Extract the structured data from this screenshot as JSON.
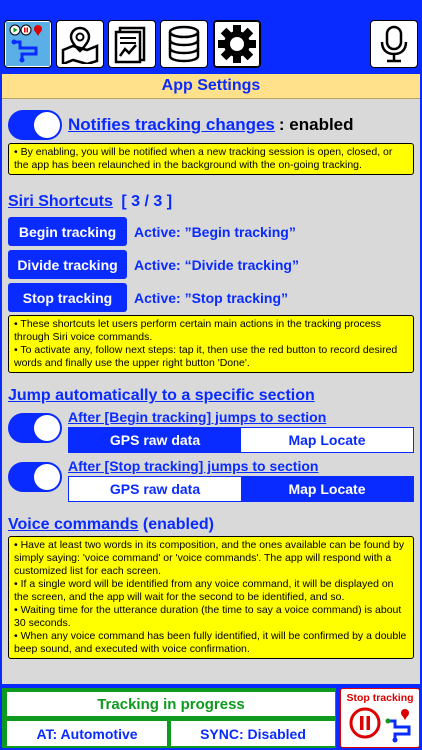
{
  "toolbar": {
    "icons": [
      "tracking-app-icon",
      "map-icon",
      "report-icon",
      "database-icon",
      "settings-icon",
      "microphone-icon"
    ]
  },
  "panel": {
    "title": "App Settings"
  },
  "notifications": {
    "label": "Notifies tracking changes",
    "status": ": enabled",
    "note": "• By enabling, you will be notified when a new tracking session is open, closed, or the app has been relaunched in the background with the on-going tracking."
  },
  "siri": {
    "title": "Siri Shortcuts",
    "count": "[ 3 / 3 ]",
    "shortcuts": [
      {
        "button": "Begin tracking",
        "active": "Active: ”Begin tracking”"
      },
      {
        "button": "Divide tracking",
        "active": "Active: “Divide tracking”"
      },
      {
        "button": "Stop tracking",
        "active": "Active: ”Stop tracking”"
      }
    ],
    "note1": "• These shortcuts let users perform certain main actions in the tracking process through Siri voice commands.",
    "note2": "• To activate any, follow next steps: tap it, then use the red button to record desired words and finally use the upper right button 'Done'."
  },
  "jump": {
    "title": "Jump automatically to a specific section",
    "begin_label": "After [Begin tracking] jumps to section",
    "stop_label": "After [Stop tracking] jumps to section",
    "option_gps": "GPS raw data",
    "option_map": "Map Locate",
    "begin_selected": "GPS raw data",
    "stop_selected": "Map Locate"
  },
  "voice": {
    "title": "Voice commands",
    "status": " (enabled)",
    "note1": "• Have at least two words in its composition, and the ones available can be found by simply saying: 'voice command' or 'voice commands'. The app will respond with a customized list for each screen.",
    "note2": "• If a single word will be identified from any voice command, it will be displayed on the screen, and the app will wait for the second to be identified, and so.",
    "note3": "• Waiting time for the utterance duration (the time to say a voice command) is about 30 seconds.",
    "note4": "• When any voice command has been fully identified, it will be confirmed by a double beep sound, and executed with voice confirmation."
  },
  "bottom": {
    "tracking_status": "Tracking in progress",
    "activity": "AT: Automotive",
    "sync": "SYNC: Disabled",
    "stop_label": "Stop tracking"
  },
  "colors": {
    "accent": "#0a2bff",
    "note_bg": "#ffff00",
    "title_bg": "#ffe18c",
    "status_green": "#0e9a1e",
    "stop_red": "#dd0000"
  }
}
